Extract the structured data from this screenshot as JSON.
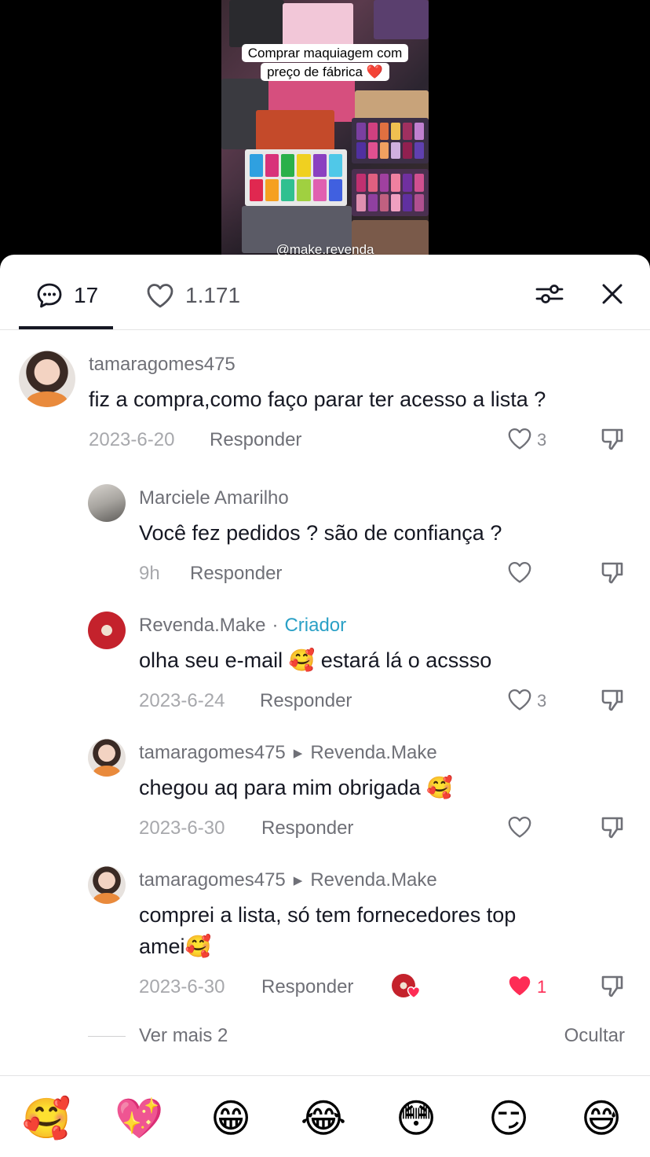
{
  "video": {
    "caption_line1": "Comprar maquiagem com",
    "caption_line2": "preço de fábrica ❤️",
    "watermark": "@make.revenda"
  },
  "header": {
    "comment_count": "17",
    "like_count": "1.171",
    "icons": [
      "comment-icon",
      "heart-outline-icon",
      "filter-sliders-icon",
      "close-icon"
    ]
  },
  "comments": [
    {
      "user": "tamaragomes475",
      "text": "fiz a compra,como faço parar ter acesso a lista ?",
      "date": "2023-6-20",
      "reply_label": "Responder",
      "likes": "3"
    },
    {
      "user": "Marciele Amarilho",
      "text": "Você fez pedidos ? são de confiança ?",
      "date": "9h",
      "reply_label": "Responder",
      "likes": ""
    },
    {
      "user": "Revenda.Make",
      "badge": "Criador",
      "separator": "·",
      "text": "olha seu e-mail 🥰 estará lá o acssso",
      "date": "2023-6-24",
      "reply_label": "Responder",
      "likes": "3"
    },
    {
      "user": "tamaragomes475",
      "reply_to": "Revenda.Make",
      "text": "chegou aq para mim obrigada 🥰",
      "date": "2023-6-30",
      "reply_label": "Responder",
      "likes": ""
    },
    {
      "user": "tamaragomes475",
      "reply_to": "Revenda.Make",
      "text_line1": "comprei a lista, só tem fornecedores top",
      "text_line2": "amei🥰",
      "date": "2023-6-30",
      "reply_label": "Responder",
      "likes": "1",
      "liked": true
    }
  ],
  "thread": {
    "see_more": "Ver mais 2",
    "hide": "Ocultar"
  },
  "emoji_bar": [
    "🥰",
    "💖",
    "😁",
    "😂",
    "😳",
    "😏",
    "😅"
  ],
  "colors": {
    "accent_red": "#fe2c55",
    "creator_blue": "#2aa0c6",
    "text_primary": "#161823",
    "text_secondary": "#6f7077"
  }
}
